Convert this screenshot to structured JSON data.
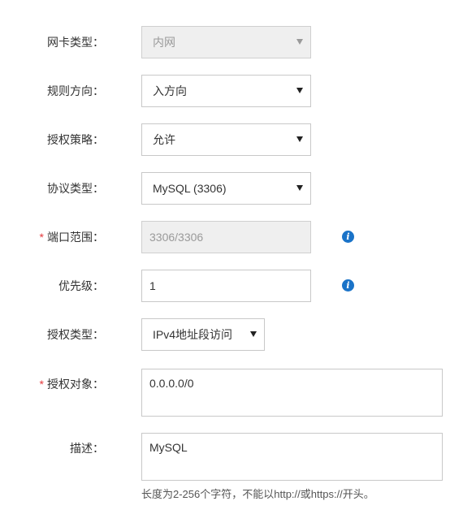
{
  "form": {
    "nic_type": {
      "label": "网卡类型：",
      "value": "内网"
    },
    "direction": {
      "label": "规则方向：",
      "value": "入方向"
    },
    "policy": {
      "label": "授权策略：",
      "value": "允许"
    },
    "protocol": {
      "label": "协议类型：",
      "value": "MySQL (3306)"
    },
    "port_range": {
      "required_mark": "*",
      "label": "端口范围：",
      "value": "3306/3306"
    },
    "priority": {
      "label": "优先级：",
      "value": "1"
    },
    "auth_type": {
      "label": "授权类型：",
      "value": "IPv4地址段访问"
    },
    "auth_object": {
      "required_mark": "*",
      "label": "授权对象：",
      "value": "0.0.0.0/0"
    },
    "description": {
      "label": "描述：",
      "value": "MySQL",
      "hint": "长度为2-256个字符，不能以http://或https://开头。"
    }
  },
  "icons": {
    "info": "info-icon"
  },
  "colors": {
    "info_blue": "#1a73c8",
    "required_red": "#e4393c",
    "disabled_bg": "#efefef"
  }
}
